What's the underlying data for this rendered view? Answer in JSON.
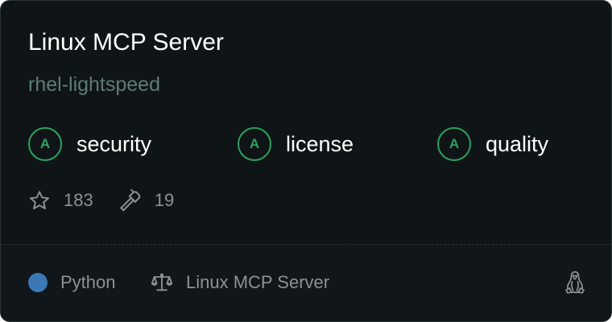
{
  "card": {
    "title": "Linux MCP Server",
    "org": "rhel-lightspeed",
    "grades": [
      {
        "grade": "A",
        "label": "security"
      },
      {
        "grade": "A",
        "label": "license"
      },
      {
        "grade": "A",
        "label": "quality"
      }
    ],
    "stats": {
      "stars": "183",
      "tools": "19"
    },
    "footer": {
      "language": "Python",
      "license": "Linux MCP Server"
    },
    "icons": {
      "stars": "star-icon",
      "tools": "hammer-icon",
      "license": "scale-icon",
      "platform": "linux-penguin-icon"
    },
    "colors": {
      "grade_accent": "#2ea05f",
      "language_dot": "#3b78b4",
      "org_text": "#5e7b75",
      "background": "#0f1517"
    }
  }
}
